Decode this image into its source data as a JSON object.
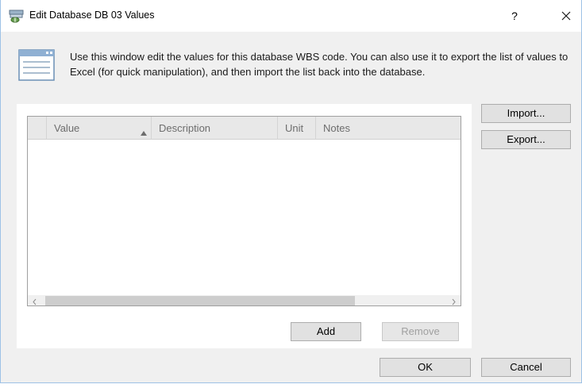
{
  "window": {
    "title": "Edit Database DB 03 Values",
    "help_glyph": "?"
  },
  "info": {
    "text": "Use this window edit the values for this database WBS code. You can also use it to export the list of values to Excel (for quick manipulation), and then import the list back into the database."
  },
  "grid": {
    "columns": [
      "Value",
      "Description",
      "Unit",
      "Notes"
    ],
    "sorted_column": "Value",
    "sort_direction": "ascending",
    "rows": []
  },
  "buttons": {
    "import": "Import...",
    "export": "Export...",
    "add": "Add",
    "remove": "Remove",
    "ok": "OK",
    "cancel": "Cancel"
  },
  "icons": {
    "title": "database-wbs-icon",
    "info": "list-window-icon",
    "close": "close-icon",
    "scroll_left": "chevron-left-icon",
    "scroll_right": "chevron-right-icon",
    "sort": "sort-ascending-icon"
  },
  "colors": {
    "window_border": "#9ec2e6",
    "dialog_background": "#f0f0f0",
    "button_face": "#e1e1e1",
    "disabled_text": "#a0a0a0"
  }
}
